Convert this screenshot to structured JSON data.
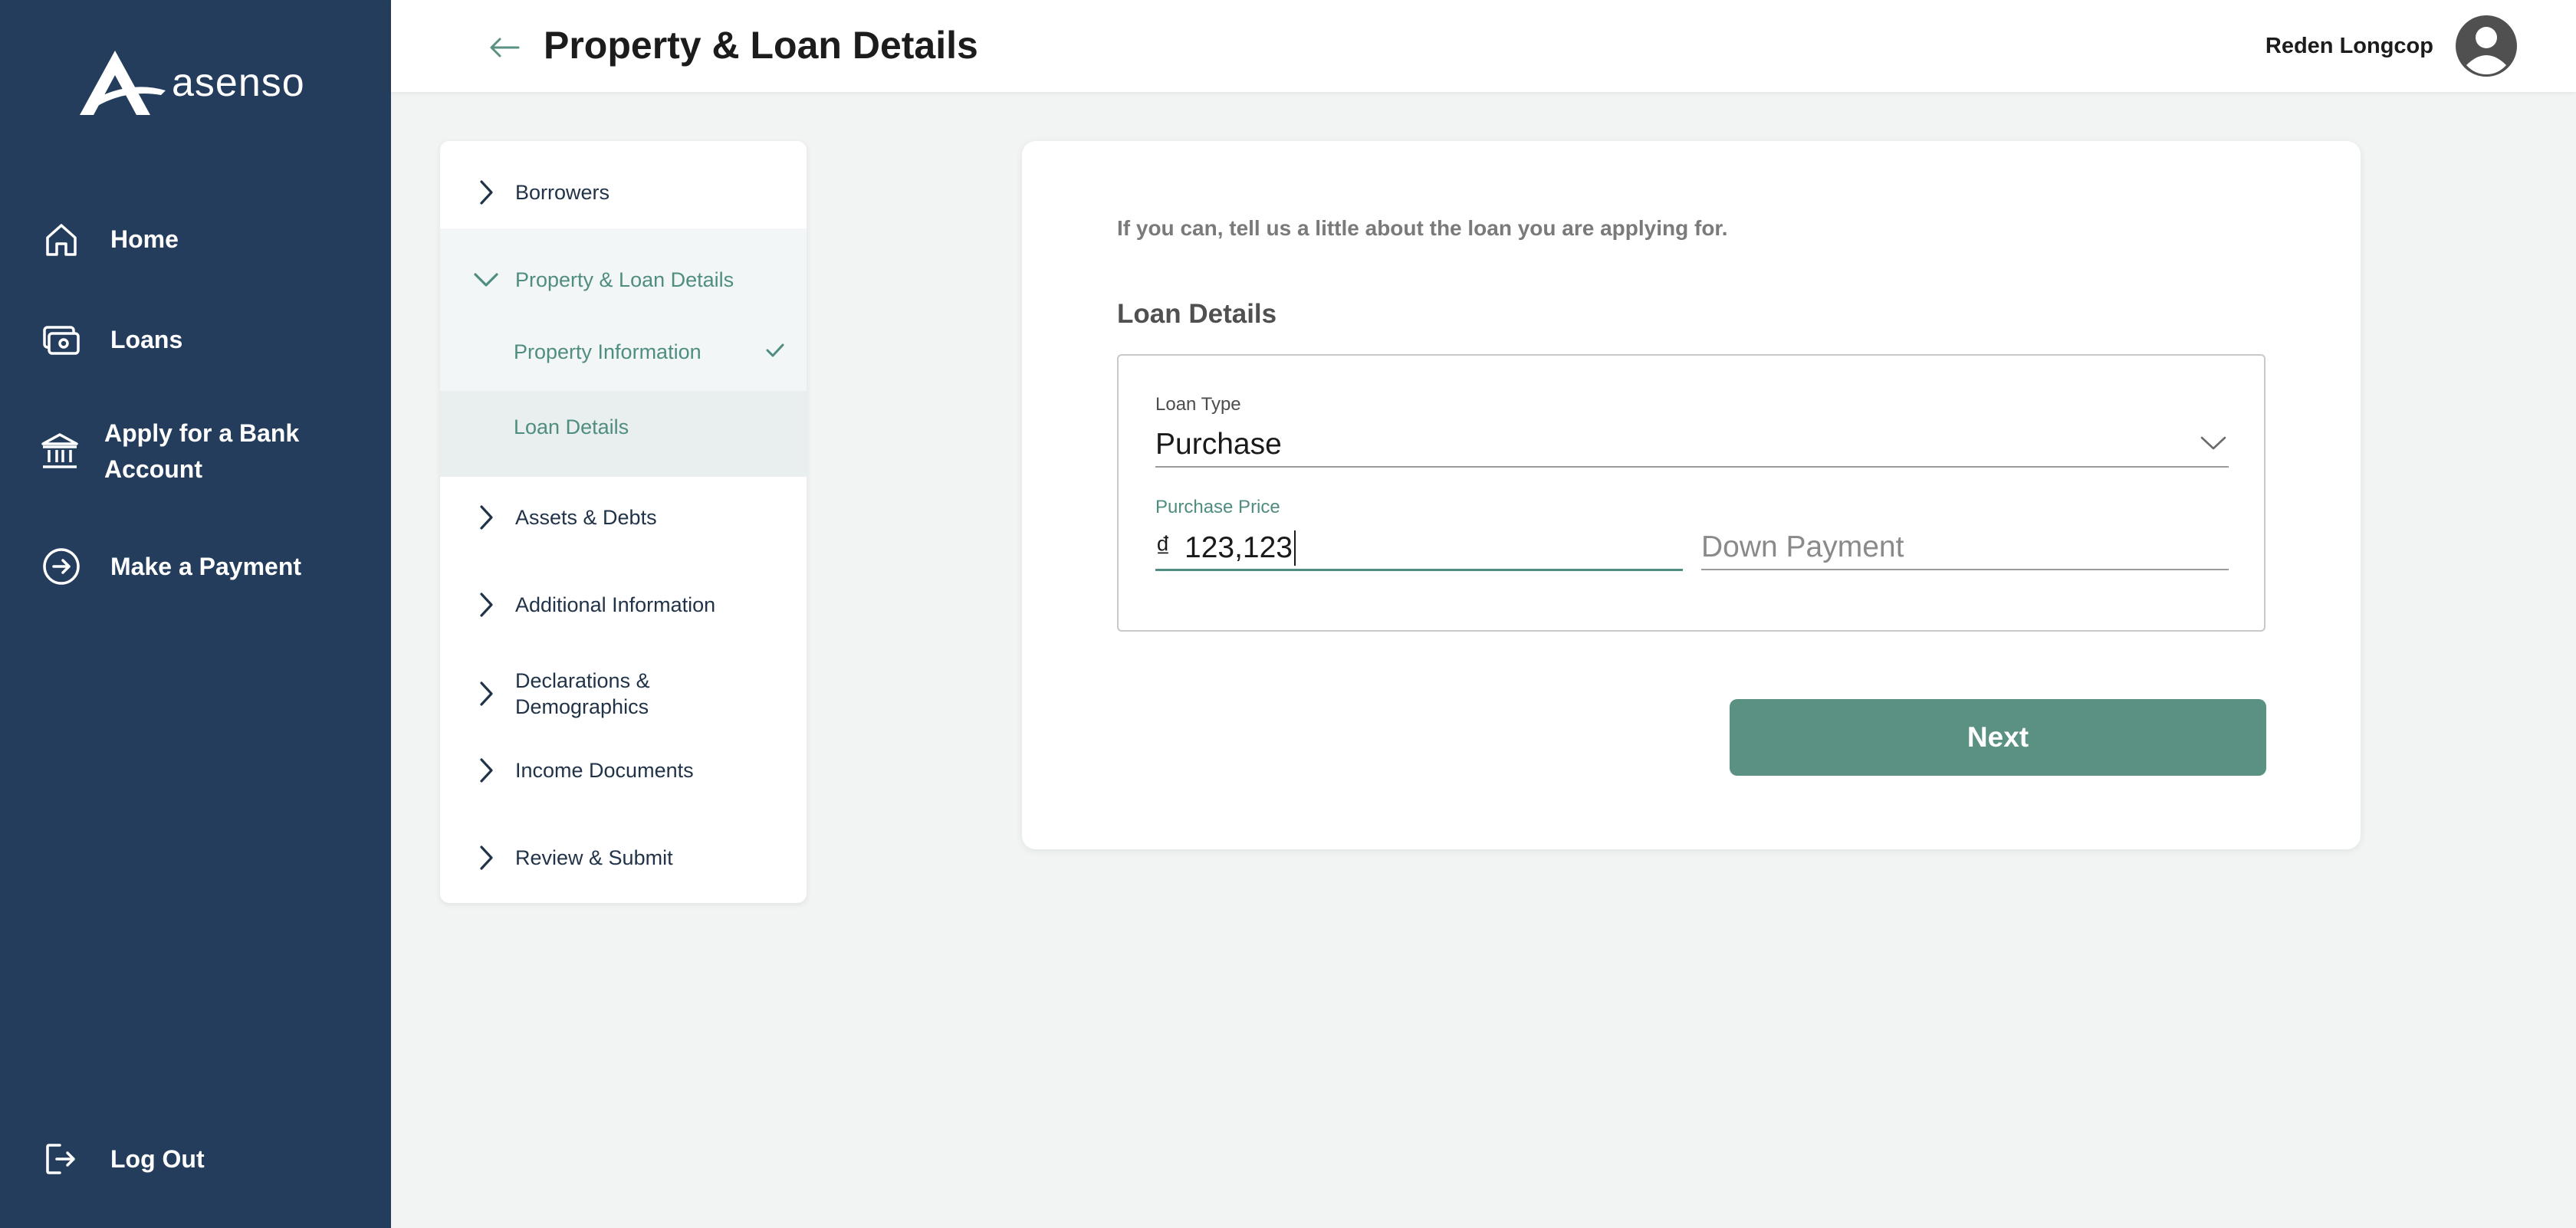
{
  "brand": {
    "name": "asenso"
  },
  "nav": {
    "home": "Home",
    "loans": "Loans",
    "bank_account": "Apply for a Bank Account",
    "payment": "Make a Payment",
    "logout": "Log Out"
  },
  "header": {
    "title": "Property & Loan Details",
    "user_name": "Reden Longcop"
  },
  "steps": {
    "borrowers": "Borrowers",
    "property_loan": "Property & Loan Details",
    "property_info": "Property Information",
    "loan_details": "Loan Details",
    "assets": "Assets & Debts",
    "additional": "Additional Information",
    "declarations": "Declarations & Demographics",
    "income": "Income Documents",
    "review": "Review & Submit"
  },
  "form": {
    "intro": "If you can, tell us a little about the loan you are applying for.",
    "section_title": "Loan Details",
    "loan_type_label": "Loan Type",
    "loan_type_value": "Purchase",
    "purchase_price_label": "Purchase Price",
    "currency_symbol": "₫",
    "purchase_price_value": "123,123",
    "down_payment_placeholder": "Down Payment",
    "next_label": "Next"
  },
  "colors": {
    "sidebar": "#253d5c",
    "accent": "#5a9183",
    "background": "#f1f4f3"
  }
}
